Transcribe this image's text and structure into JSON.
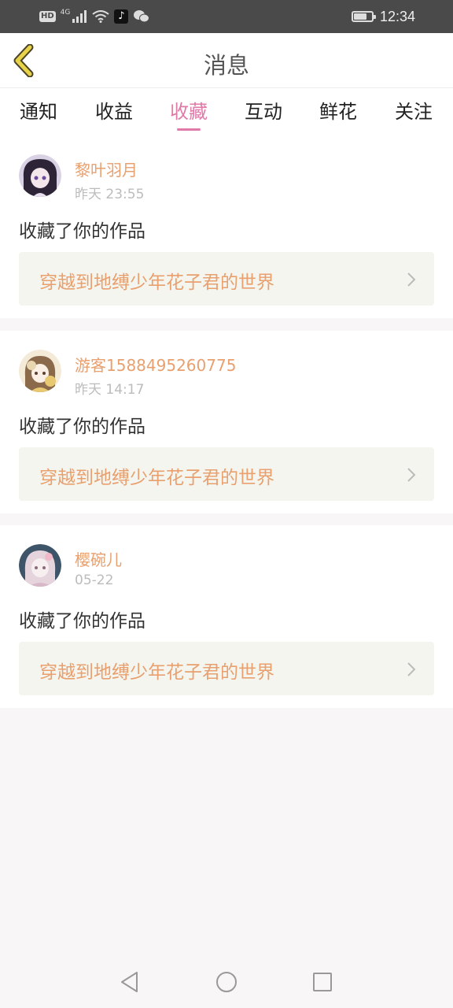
{
  "status_bar": {
    "hd": "HD",
    "network": "4G",
    "time": "12:34",
    "battery_level": 0.75
  },
  "header": {
    "title": "消息"
  },
  "tabs": [
    {
      "label": "通知",
      "active": false
    },
    {
      "label": "收益",
      "active": false
    },
    {
      "label": "收藏",
      "active": true
    },
    {
      "label": "互动",
      "active": false
    },
    {
      "label": "鲜花",
      "active": false
    },
    {
      "label": "关注",
      "active": false
    }
  ],
  "messages": [
    {
      "user": "黎叶羽月",
      "time": "昨天 23:55",
      "action": "收藏了你的作品",
      "work_title": "穿越到地缚少年花子君的世界"
    },
    {
      "user": "游客1588495260775",
      "time": "昨天 14:17",
      "action": "收藏了你的作品",
      "work_title": "穿越到地缚少年花子君的世界"
    },
    {
      "user": "樱碗儿",
      "time": "05-22",
      "action": "收藏了你的作品",
      "work_title": "穿越到地缚少年花子君的世界"
    }
  ],
  "colors": {
    "accent_pink": "#e07aa8",
    "name_orange": "#e8a06f",
    "back_yellow": "#e8d24a"
  }
}
